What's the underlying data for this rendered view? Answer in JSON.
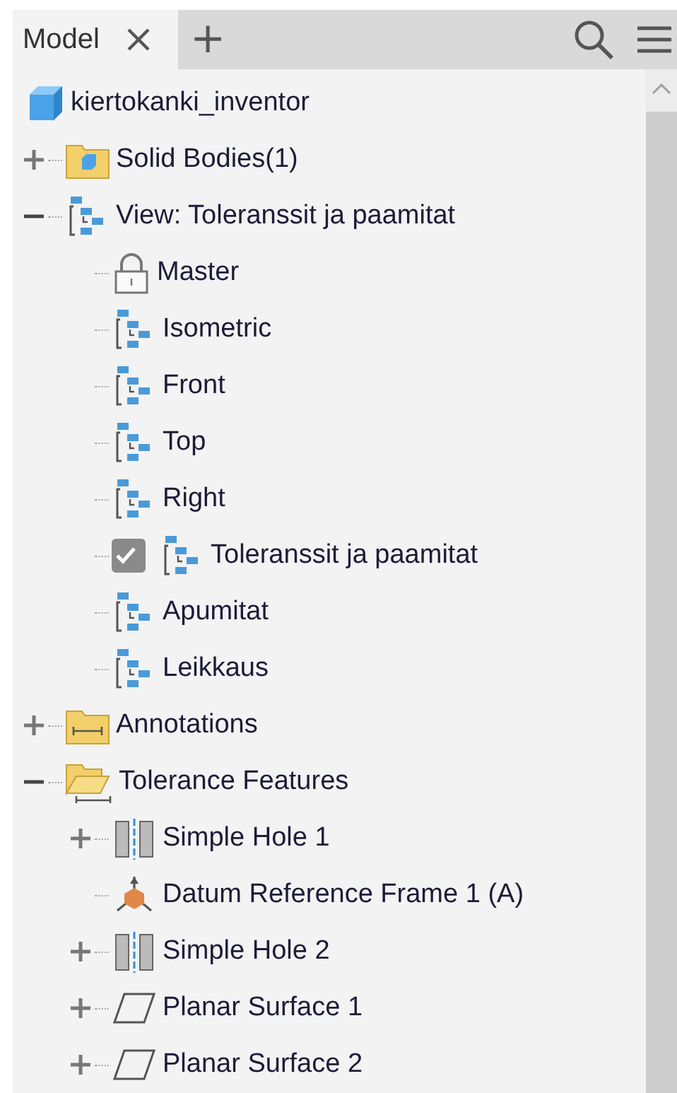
{
  "tabs": [
    {
      "label": "Model",
      "selected": true
    }
  ],
  "add_tab": {
    "symbol": "+"
  },
  "tree": {
    "label": "kiertokanki_inventor",
    "kind": "part",
    "children": [
      {
        "label": "Solid Bodies(1)",
        "kind": "body-folder",
        "expanded": false
      },
      {
        "label": "View: Toleranssit ja paamitat",
        "kind": "view",
        "expanded": true,
        "children": [
          {
            "label": "Master",
            "kind": "lock"
          },
          {
            "label": "Isometric",
            "kind": "view"
          },
          {
            "label": "Front",
            "kind": "view"
          },
          {
            "label": "Top",
            "kind": "view"
          },
          {
            "label": "Right",
            "kind": "view"
          },
          {
            "label": "Toleranssit ja paamitat",
            "kind": "view",
            "checked": true
          },
          {
            "label": "Apumitat",
            "kind": "view"
          },
          {
            "label": "Leikkaus",
            "kind": "view"
          }
        ]
      },
      {
        "label": "Annotations",
        "kind": "annotation-folder",
        "expanded": false
      },
      {
        "label": "Tolerance Features",
        "kind": "tolerance-folder",
        "expanded": true,
        "children": [
          {
            "label": "Simple Hole 1",
            "kind": "hole",
            "expanded": false
          },
          {
            "label": "Datum Reference Frame 1 (A)",
            "kind": "datum-frame"
          },
          {
            "label": "Simple Hole 2",
            "kind": "hole",
            "expanded": false
          },
          {
            "label": "Planar Surface 1",
            "kind": "plane",
            "expanded": false
          },
          {
            "label": "Planar Surface 2",
            "kind": "plane",
            "expanded": false
          }
        ]
      }
    ]
  }
}
